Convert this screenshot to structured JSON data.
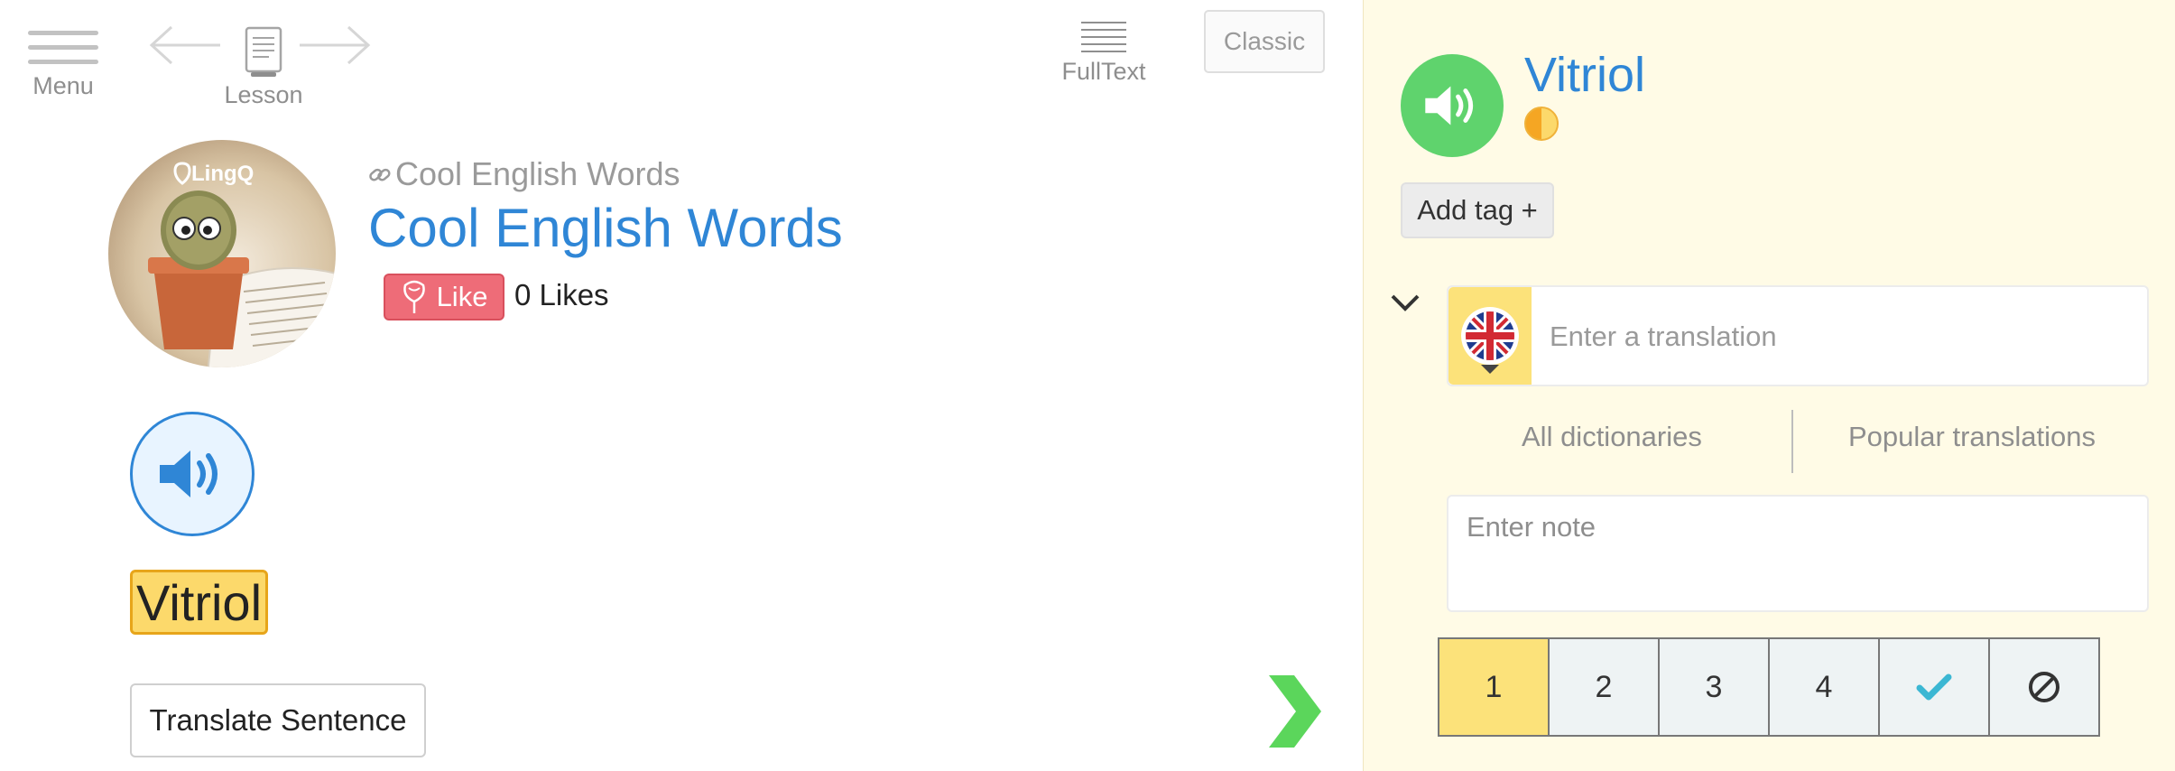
{
  "toolbar": {
    "menu_label": "Menu",
    "lesson_label": "Lesson",
    "fulltext_label": "FullText",
    "classic_label": "Classic"
  },
  "lesson": {
    "course_name": "Cool English Words",
    "title": "Cool English Words",
    "image_logo_text": "LingQ",
    "like_label": "Like",
    "likes_count": "0 Likes"
  },
  "reader": {
    "word": "Vitriol",
    "translate_sentence_label": "Translate Sentence"
  },
  "term_panel": {
    "word": "Vitriol",
    "add_tag_label": "Add tag +",
    "translation_placeholder": "Enter a translation",
    "all_dictionaries_label": "All dictionaries",
    "popular_translations_label": "Popular translations",
    "note_placeholder": "Enter note",
    "status_levels": [
      "1",
      "2",
      "3",
      "4"
    ],
    "active_status": "1"
  },
  "icons": {
    "menu": "hamburger-icon",
    "back": "arrow-left-icon",
    "lesson": "document-icon",
    "forward": "arrow-right-icon",
    "fulltext": "lines-icon",
    "link": "link-icon",
    "like": "rose-icon",
    "audio": "speaker-icon",
    "next": "chevron-right-icon",
    "collapse": "chevron-down-icon",
    "language": "uk-flag-icon",
    "known": "checkmark-icon",
    "ignore": "ignore-icon",
    "status_coin": "status-coin-icon"
  },
  "colors": {
    "accent_blue": "#2f86d6",
    "highlight_yellow": "#fcd96b",
    "like_red": "#ee6c78",
    "audio_green": "#5fd36d",
    "next_green": "#5bd65b",
    "panel_background": "#fffbe6",
    "check_teal": "#3bb7d3"
  }
}
